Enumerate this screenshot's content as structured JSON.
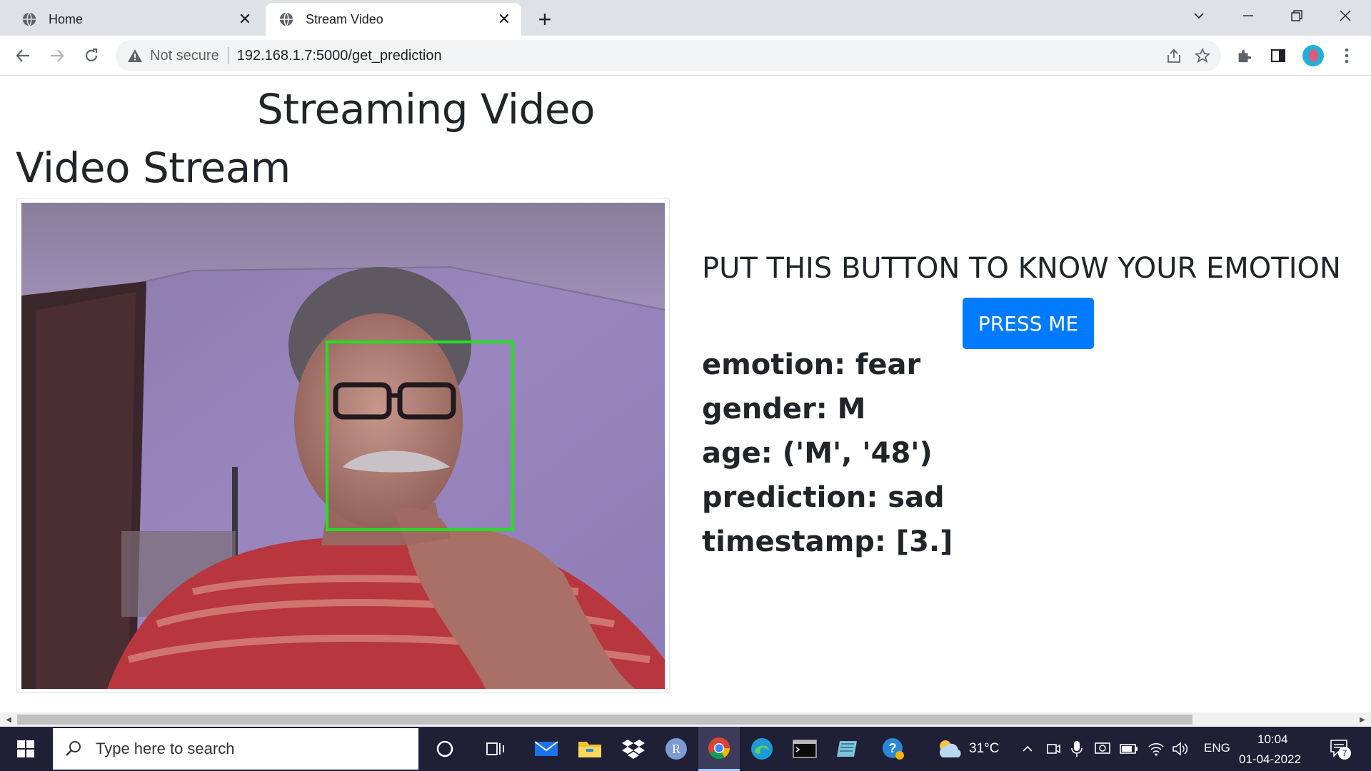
{
  "browser": {
    "tabs": [
      {
        "title": "Home",
        "active": false
      },
      {
        "title": "Stream Video",
        "active": true
      }
    ],
    "security_label": "Not secure",
    "url": "192.168.1.7:5000/get_prediction"
  },
  "page": {
    "main_title": "Streaming Video",
    "section_title": "Video Stream",
    "prompt": "PUT THIS BUTTON TO KNOW YOUR EMOTION",
    "button_label": "PRESS ME",
    "results": {
      "emotion": "emotion: fear",
      "gender": "gender: M",
      "age": "age: ('M', '48')",
      "prediction": "prediction: sad",
      "timestamp": "timestamp: [3.]"
    },
    "accent_color": "#007bff",
    "face_box_color": "#22e01f"
  },
  "taskbar": {
    "search_placeholder": "Type here to search",
    "temperature": "31°C",
    "language": "ENG",
    "time": "10:04",
    "date": "01-04-2022",
    "notification_count": "7",
    "apps": [
      "cortana-icon",
      "task-view-icon",
      "mail-icon",
      "file-explorer-icon",
      "dropbox-icon",
      "r-icon",
      "chrome-icon",
      "edge-icon",
      "terminal-icon",
      "notes-icon",
      "help-icon"
    ]
  }
}
